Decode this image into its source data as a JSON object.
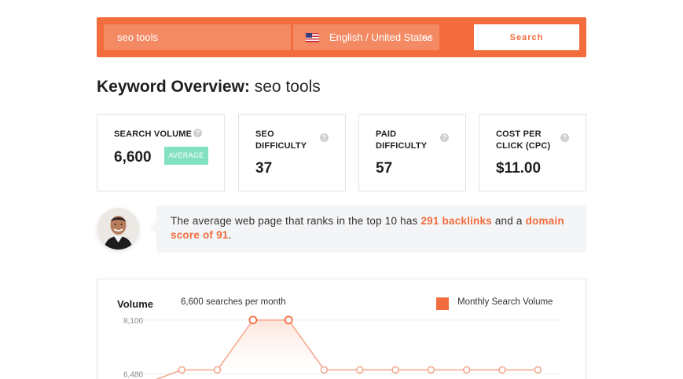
{
  "search": {
    "keyword_value": "seo tools",
    "language": "English / United States",
    "button_label": "Search"
  },
  "heading": {
    "prefix": "Keyword Overview:",
    "keyword": "seo tools"
  },
  "metrics": [
    {
      "label": "SEARCH VOLUME",
      "value": "6,600",
      "badge": "AVERAGE"
    },
    {
      "label": "SEO\nDIFFICULTY",
      "value": "37"
    },
    {
      "label": "PAID\nDIFFICULTY",
      "value": "57"
    },
    {
      "label": "COST PER\nCLICK (CPC)",
      "value": "$11.00"
    }
  ],
  "help_glyph": "?",
  "tip": {
    "before": "The average web page that ranks in the top 10 has ",
    "backlinks": "291 backlinks",
    "middle": " and a ",
    "domain_score": "domain score of 91",
    "after": "."
  },
  "chart": {
    "title": "Volume",
    "subtitle": "6,600 searches per month",
    "legend": "Monthly Search Volume"
  },
  "chart_data": {
    "type": "area",
    "title": "Volume",
    "xlabel": "",
    "ylabel": "",
    "tick_labels": [
      "8,100",
      "6,480"
    ],
    "ylim": [
      5900,
      8900
    ],
    "series": [
      {
        "name": "Monthly Search Volume",
        "values": [
          6200,
          6600,
          6600,
          8100,
          8100,
          6600,
          6600,
          6600,
          6600,
          6600,
          6600,
          6600
        ]
      }
    ],
    "grid": true,
    "legend_position": "top-right",
    "colors": {
      "line": "#f4a58b",
      "marker_fill": "#ffffff",
      "area": "#fde3d8",
      "accent": "#f26c3d"
    }
  },
  "colors": {
    "brand": "#f26c3d",
    "input_bg": "#f48a63",
    "badge": "#83e1c3",
    "tip_bg": "#f4f5f7"
  }
}
